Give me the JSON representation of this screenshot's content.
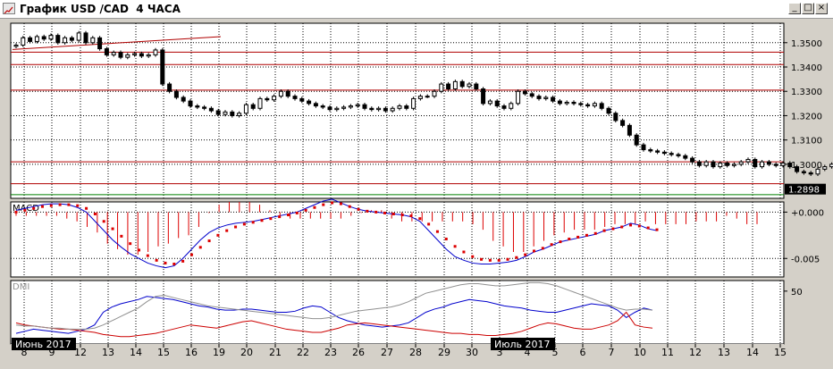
{
  "window": {
    "title": "График USD /CAD  4 ЧАСА",
    "minimize_glyph": "_",
    "maximize_glyph": "□",
    "close_glyph": "×"
  },
  "colors": {
    "background": "#ffffff",
    "frame": "#d4d0c8",
    "grid": "#000000",
    "candle": "#000000",
    "level_line": "#b00000",
    "trend_line": "#b00000",
    "support_line": "#008000",
    "macd_line": "#0000cc",
    "macd_signal": "#dd0000",
    "macd_hist": "#dd0000",
    "dmi_plus": "#0000cc",
    "dmi_minus": "#cc0000",
    "adx": "#909090"
  },
  "chart_data": [
    {
      "type": "candlestick",
      "panel": "price",
      "ylim": [
        1.286,
        1.358
      ],
      "y_ticks": [
        "1.3500",
        "1.3400",
        "1.3300",
        "1.3200",
        "1.3100",
        "1.3000"
      ],
      "current_price": "1.2898",
      "x_tick_labels": [
        "8",
        "9",
        "12",
        "13",
        "14",
        "15",
        "16",
        "19",
        "20",
        "21",
        "22",
        "23",
        "26",
        "27",
        "28",
        "29",
        "30",
        "3",
        "4",
        "5",
        "6",
        "7",
        "10",
        "11",
        "12",
        "13",
        "14",
        "15"
      ],
      "period_labels": [
        "Июнь 2017",
        "Июль 2017"
      ],
      "horizontal_levels": [
        1.3461,
        1.341,
        1.3305,
        1.301,
        1.292
      ],
      "support_level": 1.2875,
      "trend_line": {
        "from": [
          0,
          1.3472
        ],
        "to": [
          74,
          1.3525
        ]
      },
      "closes": [
        1.349,
        1.352,
        1.3505,
        1.3525,
        1.3515,
        1.353,
        1.35,
        1.352,
        1.351,
        1.354,
        1.35,
        1.352,
        1.3475,
        1.345,
        1.346,
        1.344,
        1.345,
        1.3455,
        1.3445,
        1.345,
        1.347,
        1.333,
        1.33,
        1.3275,
        1.326,
        1.324,
        1.3235,
        1.323,
        1.322,
        1.3205,
        1.3215,
        1.32,
        1.321,
        1.3245,
        1.323,
        1.327,
        1.3265,
        1.328,
        1.33,
        1.328,
        1.327,
        1.326,
        1.325,
        1.324,
        1.3235,
        1.3225,
        1.323,
        1.3235,
        1.324,
        1.3245,
        1.323,
        1.3225,
        1.323,
        1.322,
        1.323,
        1.324,
        1.323,
        1.327,
        1.328,
        1.328,
        1.33,
        1.333,
        1.331,
        1.334,
        1.332,
        1.333,
        1.331,
        1.325,
        1.326,
        1.324,
        1.323,
        1.325,
        1.33,
        1.329,
        1.328,
        1.327,
        1.3275,
        1.326,
        1.325,
        1.3255,
        1.325,
        1.3245,
        1.324,
        1.325,
        1.323,
        1.321,
        1.318,
        1.316,
        1.312,
        1.308,
        1.306,
        1.3055,
        1.305,
        1.3045,
        1.304,
        1.3035,
        1.3025,
        1.301,
        1.2995,
        1.301,
        1.299,
        1.3005,
        1.2995,
        1.3,
        1.301,
        1.302,
        1.299,
        1.301,
        1.3,
        1.2995,
        1.3005,
        1.299,
        1.297,
        1.2965,
        1.296,
        1.298,
        1.299,
        1.3,
        1.2985,
        1.2975,
        1.2965,
        1.298,
        1.296,
        1.297,
        1.299,
        1.3005,
        1.3015,
        1.2975,
        1.292,
        1.289,
        1.29,
        1.2898
      ],
      "x_axis_label": "",
      "y_axis_label": ""
    },
    {
      "type": "line",
      "panel": "macd",
      "name": "MACD",
      "ylim": [
        -0.007,
        0.0011
      ],
      "y_ticks": [
        "+0.000",
        "-0.005"
      ],
      "series": [
        {
          "name": "macd",
          "values": [
            0.0002,
            0.0004,
            0.0006,
            0.0008,
            0.0009,
            0.0009,
            0.0008,
            0.0005,
            0.0,
            -0.001,
            -0.002,
            -0.003,
            -0.0038,
            -0.0045,
            -0.005,
            -0.0055,
            -0.0058,
            -0.006,
            -0.0058,
            -0.005,
            -0.004,
            -0.003,
            -0.0022,
            -0.0017,
            -0.0014,
            -0.0012,
            -0.0011,
            -0.001,
            -0.0008,
            -0.0006,
            -0.0004,
            -0.0002,
            0.0,
            0.0004,
            0.0008,
            0.0012,
            0.0014,
            0.001,
            0.0006,
            0.0003,
            0.0001,
            0.0,
            -0.0001,
            -0.0002,
            -0.0003,
            -0.0005,
            -0.001,
            -0.002,
            -0.003,
            -0.004,
            -0.0048,
            -0.0052,
            -0.0055,
            -0.0056,
            -0.0056,
            -0.0055,
            -0.0054,
            -0.0052,
            -0.0048,
            -0.0043,
            -0.004,
            -0.0036,
            -0.0032,
            -0.003,
            -0.0028,
            -0.0026,
            -0.0024,
            -0.002,
            -0.0018,
            -0.0016,
            -0.0012,
            -0.0014,
            -0.0018,
            -0.002
          ]
        },
        {
          "name": "signal",
          "values": [
            0.0,
            0.0002,
            0.0004,
            0.0006,
            0.0007,
            0.0008,
            0.0008,
            0.0007,
            0.0004,
            -0.0002,
            -0.001,
            -0.0018,
            -0.0026,
            -0.0034,
            -0.0041,
            -0.0047,
            -0.0052,
            -0.0055,
            -0.0056,
            -0.0053,
            -0.0046,
            -0.0038,
            -0.0031,
            -0.0025,
            -0.002,
            -0.0016,
            -0.0013,
            -0.0011,
            -0.0009,
            -0.0007,
            -0.0005,
            -0.0003,
            -0.0001,
            0.0002,
            0.0005,
            0.0008,
            0.001,
            0.0009,
            0.0006,
            0.0003,
            0.0001,
            0.0,
            -0.0001,
            -0.0002,
            -0.0003,
            -0.0004,
            -0.0007,
            -0.0013,
            -0.0021,
            -0.0029,
            -0.0037,
            -0.0043,
            -0.0048,
            -0.0051,
            -0.0052,
            -0.0052,
            -0.0051,
            -0.0049,
            -0.0046,
            -0.0042,
            -0.0039,
            -0.0035,
            -0.0032,
            -0.0029,
            -0.0027,
            -0.0025,
            -0.0023,
            -0.002,
            -0.0018,
            -0.0016,
            -0.0014,
            -0.0015,
            -0.0017,
            -0.0019
          ]
        }
      ]
    },
    {
      "type": "line",
      "panel": "dmi",
      "name": "DMI",
      "ylim": [
        0,
        60
      ],
      "y_ticks": [
        "50"
      ],
      "series": [
        {
          "name": "plus_di",
          "values": [
            10,
            12,
            14,
            13,
            12,
            11,
            10,
            12,
            14,
            18,
            30,
            35,
            38,
            40,
            42,
            45,
            44,
            43,
            42,
            40,
            38,
            36,
            35,
            33,
            32,
            32,
            33,
            33,
            32,
            31,
            30,
            30,
            31,
            34,
            36,
            35,
            30,
            25,
            22,
            20,
            18,
            17,
            16,
            17,
            18,
            20,
            25,
            30,
            33,
            35,
            38,
            40,
            42,
            41,
            40,
            38,
            36,
            35,
            34,
            32,
            31,
            30,
            30,
            32,
            34,
            36,
            38,
            37,
            36,
            32,
            25,
            30,
            34,
            32
          ]
        },
        {
          "name": "minus_di",
          "values": [
            20,
            18,
            17,
            16,
            15,
            14,
            14,
            13,
            12,
            11,
            9,
            8,
            7,
            7,
            8,
            9,
            10,
            12,
            14,
            16,
            18,
            17,
            16,
            15,
            17,
            19,
            21,
            22,
            20,
            18,
            16,
            14,
            13,
            12,
            11,
            11,
            13,
            15,
            18,
            19,
            20,
            19,
            18,
            17,
            16,
            15,
            14,
            13,
            12,
            11,
            10,
            10,
            9,
            9,
            8,
            8,
            9,
            10,
            12,
            15,
            18,
            20,
            19,
            17,
            15,
            14,
            14,
            16,
            18,
            22,
            30,
            18,
            16,
            15
          ]
        },
        {
          "name": "adx",
          "values": [
            18,
            17,
            17,
            16,
            15,
            15,
            14,
            14,
            14,
            15,
            18,
            22,
            26,
            30,
            34,
            40,
            45,
            46,
            44,
            42,
            40,
            38,
            36,
            35,
            34,
            33,
            32,
            31,
            30,
            29,
            28,
            27,
            26,
            25,
            24,
            24,
            25,
            27,
            29,
            31,
            32,
            33,
            34,
            35,
            37,
            40,
            44,
            48,
            50,
            52,
            54,
            56,
            57,
            57,
            56,
            55,
            55,
            56,
            57,
            58,
            58,
            57,
            55,
            52,
            49,
            46,
            43,
            40,
            37,
            34,
            32,
            33,
            33,
            32
          ]
        }
      ]
    }
  ]
}
